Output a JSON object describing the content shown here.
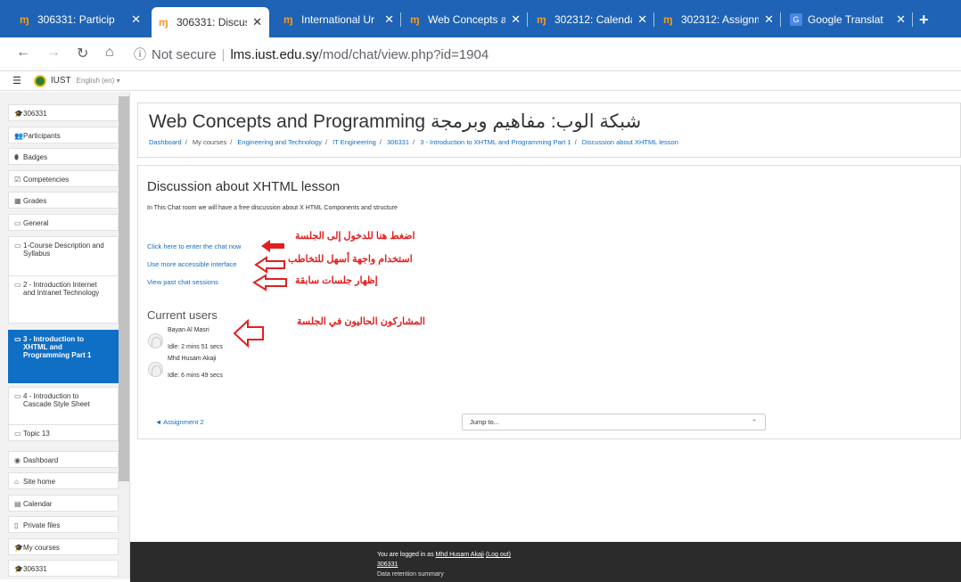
{
  "browser": {
    "tabs": [
      {
        "favicon": "moodle-icon",
        "title": "306331: Particip"
      },
      {
        "favicon": "moodle-icon",
        "title": "306331: Discuss",
        "active": true
      },
      {
        "favicon": "moodle-icon",
        "title": "International Ur"
      },
      {
        "favicon": "moodle-icon",
        "title": "Web Concepts a"
      },
      {
        "favicon": "moodle-icon",
        "title": "302312: Calenda"
      },
      {
        "favicon": "moodle-icon",
        "title": "302312: Assignm"
      },
      {
        "favicon": "google-translate-icon",
        "title": "Google Translat"
      }
    ],
    "new_tab": "+",
    "security": "Not secure",
    "url_host": "lms.iust.edu.sy",
    "url_path": "/mod/chat/view.php?id=1904"
  },
  "navbar": {
    "brand": "IUST",
    "language": "English (en) ▾"
  },
  "sidebar": {
    "items": [
      {
        "icon": "graduation-cap-icon",
        "glyph": "🎓",
        "label": "306331"
      },
      {
        "icon": "users-icon",
        "glyph": "👥",
        "label": "Participants"
      },
      {
        "icon": "shield-icon",
        "glyph": "⬮",
        "label": "Badges"
      },
      {
        "icon": "checkbox-icon",
        "glyph": "☑",
        "label": "Competencies"
      },
      {
        "icon": "table-icon",
        "glyph": "▦",
        "label": "Grades"
      },
      {
        "icon": "folder-icon",
        "glyph": "▭",
        "label": "General"
      },
      {
        "icon": "folder-icon",
        "glyph": "▭",
        "label": "1-Course Description and Syllabus"
      },
      {
        "icon": "folder-icon",
        "glyph": "▭",
        "label": "2 - Introduction Internet and Intranet Technology"
      },
      {
        "icon": "folder-icon",
        "glyph": "▭",
        "label": "3 - Introduction to XHTML and Programming Part 1",
        "active": true
      },
      {
        "icon": "folder-icon",
        "glyph": "▭",
        "label": "4 - Introduction to Cascade Style Sheet"
      },
      {
        "icon": "folder-icon",
        "glyph": "▭",
        "label": "Topic 13"
      },
      {
        "icon": "dashboard-icon",
        "glyph": "◉",
        "label": "Dashboard"
      },
      {
        "icon": "home-icon",
        "glyph": "⌂",
        "label": "Site home"
      },
      {
        "icon": "calendar-icon",
        "glyph": "▤",
        "label": "Calendar"
      },
      {
        "icon": "file-icon",
        "glyph": "▯",
        "label": "Private files"
      },
      {
        "icon": "graduation-cap-icon",
        "glyph": "🎓",
        "label": "My courses"
      },
      {
        "icon": "graduation-cap-icon",
        "glyph": "🎓",
        "label": "306331"
      }
    ]
  },
  "header": {
    "title": "Web Concepts and Programming شبكة الوب: مفاهيم وبرمجة",
    "breadcrumb": [
      "Dashboard",
      "My courses",
      "Engineering and Technology",
      "IT Engineering",
      "306331",
      "3 - Introduction to XHTML and Programming Part 1",
      "Discussion about XHTML lesson"
    ]
  },
  "activity": {
    "title": "Discussion about XHTML lesson",
    "description": "In This Chat room we  will  have a free discussion  about  X HTML Components and structure",
    "links": {
      "enter_chat": "Click here to enter the chat now",
      "accessible": "Use more accessible interface",
      "past_sessions": "View past chat sessions"
    },
    "annotations": {
      "enter_chat": "اضغط هنا للدخول إلى الجلسة",
      "accessible": "استخدام واجهة أسهل للتخاطب",
      "past_sessions": "إظهار جلسات سابقة",
      "current_users": "المشاركون الحاليون في الجلسة"
    },
    "annotation_color": "#e02020",
    "current_users_title": "Current users",
    "users": [
      {
        "name": "Bayan Al Masri",
        "idle": "Idle: 2 mins 51 secs"
      },
      {
        "name": "Mhd Husam Akaji",
        "idle": "Idle: 6 mins 49 secs"
      }
    ]
  },
  "activity_nav": {
    "previous": "◄ Assignment 2",
    "jump_to": "Jump to...",
    "jump_caret": "÷"
  },
  "footer": {
    "logged_in_prefix": "You are logged in as ",
    "user": "Mhd Husam Akaji",
    "logout": "(Log out)",
    "course": "306331",
    "partial": "Data retention summary"
  },
  "colors": {
    "tabbar": "#1e63b5",
    "link": "#0f6fc5",
    "active_item": "#0f6fc5",
    "footer": "#2b2b2b"
  }
}
